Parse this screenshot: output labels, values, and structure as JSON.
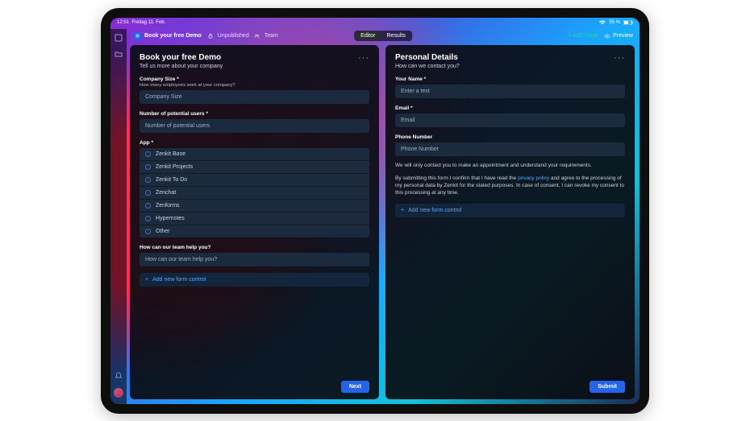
{
  "status": {
    "time": "12:51",
    "date": "Freitag 11. Feb.",
    "battery": "55 %"
  },
  "appbar": {
    "title": "Book your free Demo",
    "unpublished": "Unpublished",
    "team": "Team",
    "seg_editor": "Editor",
    "seg_results": "Results",
    "add_page": "Add Page",
    "preview": "Preview"
  },
  "left": {
    "title": "Book your free Demo",
    "subtitle": "Tell us more about your company",
    "company_size_label": "Company Size *",
    "company_size_hint": "How many employees work at your company?",
    "company_size_placeholder": "Company Size",
    "users_label": "Number of potential users *",
    "users_placeholder": "Number of potential users",
    "app_label": "App *",
    "options": [
      "Zenkit Base",
      "Zenkit Projects",
      "Zenkit To Do",
      "Zenchat",
      "Zenforms",
      "Hypernotes",
      "Other"
    ],
    "help_label": "How can our team help you?",
    "help_placeholder": "How can our team help you?",
    "add_control": "Add new form control",
    "next": "Next"
  },
  "right": {
    "title": "Personal Details",
    "subtitle": "How can we contact you?",
    "name_label": "Your Name *",
    "name_placeholder": "Enter a text",
    "email_label": "Email *",
    "email_placeholder": "Email",
    "phone_label": "Phone Number",
    "phone_placeholder": "Phone Number",
    "para1": "We will only contact you to make an appointment and understand your requirements.",
    "para2a": "By submitting this form I confirm that I have read the ",
    "para2link": "privacy policy",
    "para2b": " and agree to the processing of my personal data by Zenkit for the stated purposes. In case of consent, I can revoke my consent to this processing at any time.",
    "add_control": "Add new form control",
    "submit": "Submit"
  }
}
